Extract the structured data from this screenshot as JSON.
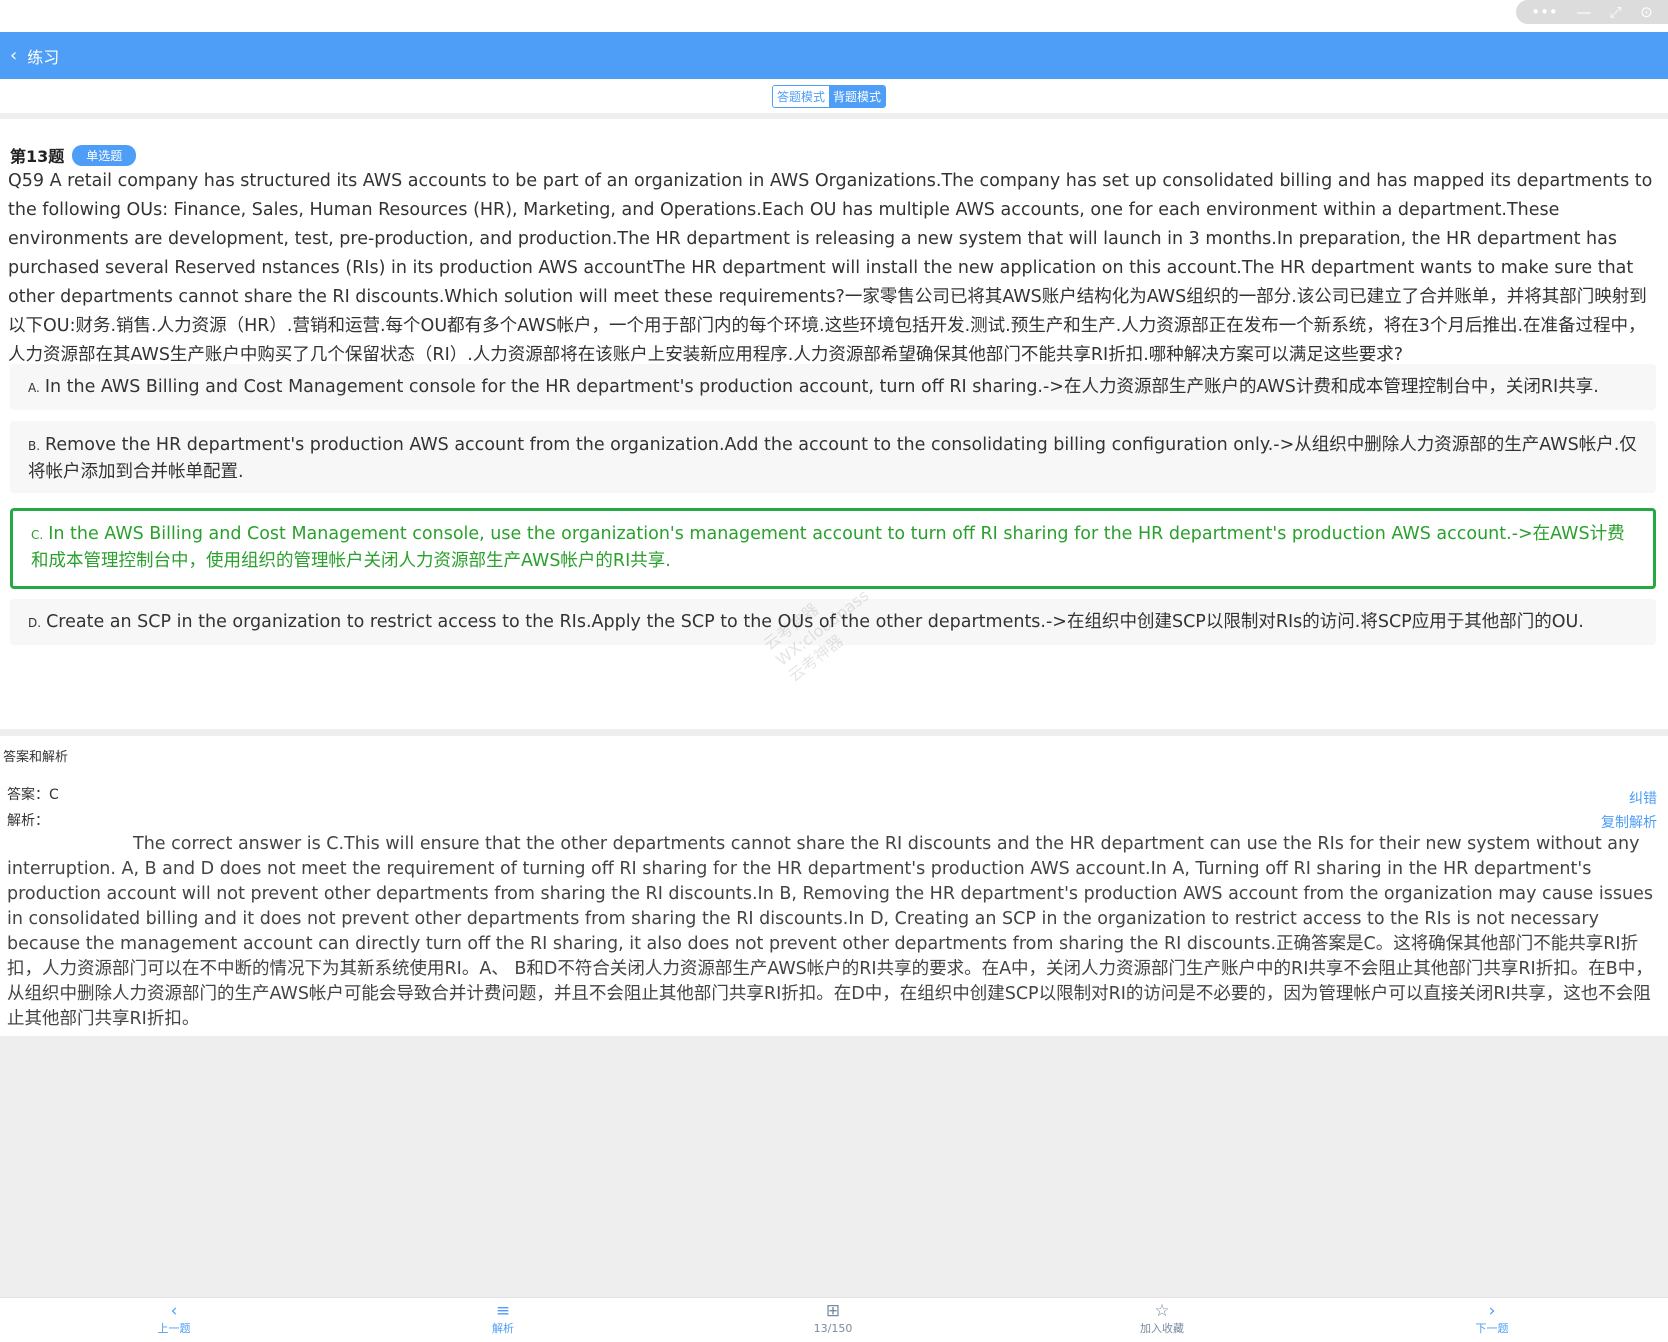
{
  "window_controls": {
    "more_icon": "•••",
    "minimize_icon": "—",
    "restore_icon": "⤢",
    "close_icon": "⊙"
  },
  "appbar": {
    "back_icon": "‹",
    "title": "练习"
  },
  "mode": {
    "answer_mode": "答题模式",
    "recite_mode": "背题模式"
  },
  "question": {
    "number": "第13题",
    "type": "单选题",
    "text": "Q59 A retail company has structured its AWS accounts to be part of an organization in AWS Organizations.The company has set up consolidated billing and has mapped its departments to the following OUs: Finance, Sales, Human Resources (HR), Marketing, and Operations.Each OU has multiple AWS accounts, one for each environment within a department.These environments are development, test, pre-production, and production.The HR department is releasing a new system that will launch in 3 months.In preparation, the HR department has purchased several Reserved nstances (RIs) in its production AWS accountThe HR department will install the new application on this account.The HR department wants to make sure that other departments cannot share the RI discounts.Which solution will meet these requirements?一家零售公司已将其AWS账户结构化为AWS组织的一部分.该公司已建立了合并账单，并将其部门映射到以下OU:财务.销售.人力资源（HR）.营销和运营.每个OU都有多个AWS帐户，一个用于部门内的每个环境.这些环境包括开发.测试.预生产和生产.人力资源部正在发布一个新系统，将在3个月后推出.在准备过程中，人力资源部在其AWS生产账户中购买了几个保留状态（RI）.人力资源部将在该账户上安装新应用程序.人力资源部希望确保其他部门不能共享RI折扣.哪种解决方案可以满足这些要求?",
    "options": [
      {
        "letter": "A.",
        "text": "In the AWS Billing and Cost Management console for the HR department's production account, turn off RI sharing.->在人力资源部生产账户的AWS计费和成本管理控制台中，关闭RI共享."
      },
      {
        "letter": "B.",
        "text": "Remove the HR department's production AWS account from the organization.Add the account to the consolidating billing configuration only.->从组织中删除人力资源部的生产AWS帐户.仅将帐户添加到合并帐单配置."
      },
      {
        "letter": "C.",
        "text": "In the AWS Billing and Cost Management console, use the organization's management account to turn off RI sharing for the HR department's production AWS account.->在AWS计费和成本管理控制台中，使用组织的管理帐户关闭人力资源部生产AWS帐户的RI共享."
      },
      {
        "letter": "D.",
        "text": "Create an SCP in the organization to restrict access to the RIs.Apply the SCP to the OUs of the other departments.->在组织中创建SCP以限制对RIs的访问.将SCP应用于其他部门的OU."
      }
    ]
  },
  "watermark": {
    "line1": "云考神器",
    "line2": "WX:cloudpass",
    "line3": "云考神器"
  },
  "analysis": {
    "header": "答案和解析",
    "answer_label": "答案：C",
    "explanation_label": "解析：",
    "report_error": "纠错",
    "copy_explanation": "复制解析",
    "text": "The correct answer is C.This will ensure that the other departments cannot share the RI discounts and the HR department can use the RIs for their new system without any interruption. A, B and D does not meet the requirement of turning off RI sharing for the HR department's production AWS account.In A, Turning off RI sharing in the HR department's production account will not prevent other departments from sharing the RI discounts.In B, Removing the HR department's production AWS account from the organization may cause issues in consolidated billing and it does not prevent other departments from sharing the RI discounts.In D, Creating an SCP in the organization to restrict access to the RIs is not necessary because the management account can directly turn off the RI sharing, it also does not prevent other departments from sharing the RI discounts.正确答案是C。这将确保其他部门不能共享RI折扣，人力资源部门可以在不中断的情况下为其新系统使用RI。A、 B和D不符合关闭人力资源部生产AWS帐户的RI共享的要求。在A中，关闭人力资源部门生产账户中的RI共享不会阻止其他部门共享RI折扣。在B中，从组织中删除人力资源部门的生产AWS帐户可能会导致合并计费问题，并且不会阻止其他部门共享RI折扣。在D中，在组织中创建SCP以限制对RI的访问是不必要的，因为管理帐户可以直接关闭RI共享，这也不会阻止其他部门共享RI折扣。"
  },
  "footer": {
    "prev": {
      "icon": "‹",
      "label": "上一题"
    },
    "explain": {
      "icon": "≡",
      "label": "解析"
    },
    "progress": {
      "icon": "⊞",
      "label": "13/150"
    },
    "favorite": {
      "icon": "☆",
      "label": "加入收藏"
    },
    "next": {
      "icon": "›",
      "label": "下一题"
    }
  }
}
